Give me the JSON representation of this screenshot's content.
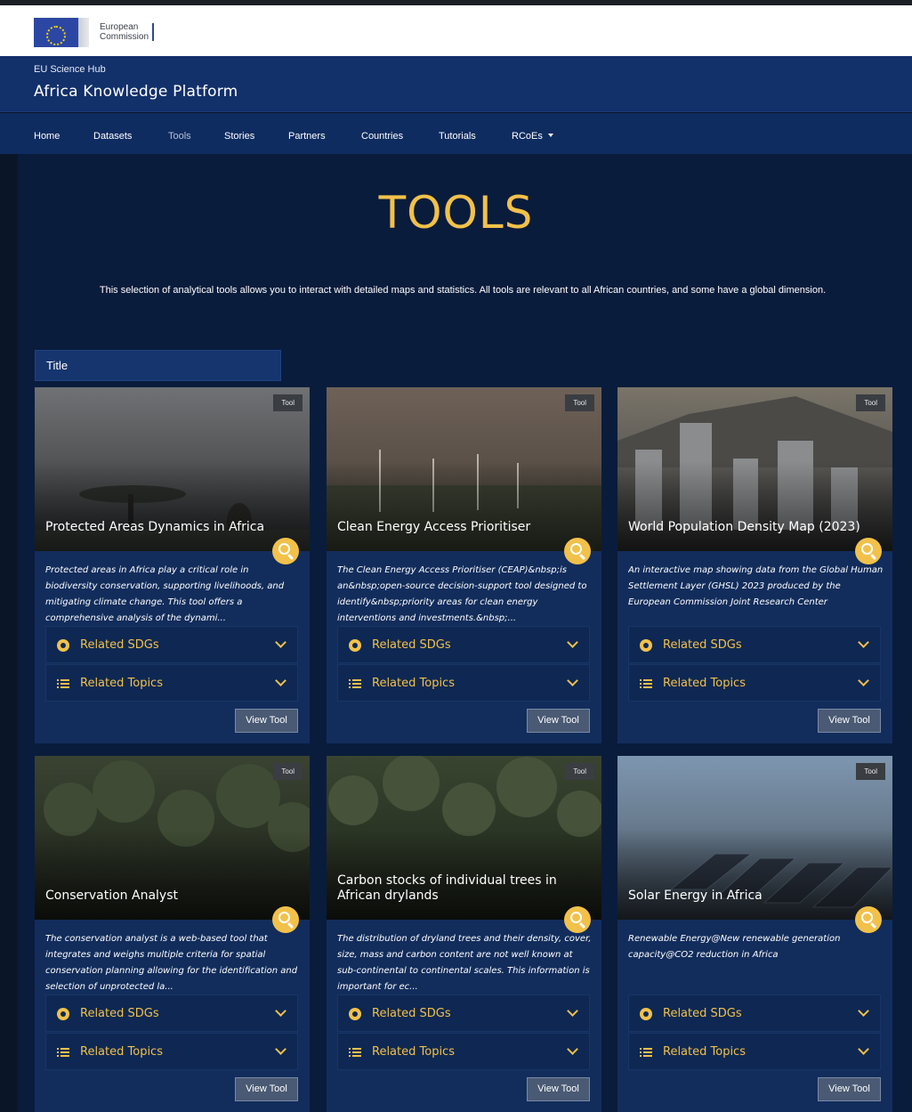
{
  "ec": {
    "line1": "European",
    "line2": "Commission"
  },
  "site": {
    "org": "EU Science Hub",
    "title": "Africa Knowledge Platform"
  },
  "nav": [
    {
      "label": "Home",
      "active": false
    },
    {
      "label": "Datasets",
      "active": false
    },
    {
      "label": "Tools",
      "active": true
    },
    {
      "label": "Stories",
      "active": false
    },
    {
      "label": "Partners",
      "active": false
    },
    {
      "label": "Countries",
      "active": false
    },
    {
      "label": "Tutorials",
      "active": false
    },
    {
      "label": "RCoEs",
      "active": false,
      "dropdown": true
    }
  ],
  "page": {
    "title": "TOOLS",
    "intro": "This selection of analytical tools allows you to interact with detailed maps and statistics. All tools are relevant to all African countries, and some have a global dimension."
  },
  "filter": {
    "label": "Title"
  },
  "common": {
    "badge": "Tool",
    "sdg_label": "Related SDGs",
    "topics_label": "Related Topics",
    "view_label": "View Tool"
  },
  "cards": [
    {
      "title": "Protected Areas Dynamics in Africa",
      "desc": "Protected areas in Africa play a critical role in biodiversity conservation, supporting livelihoods, and mitigating climate change. This tool offers a comprehensive analysis of the dynami..."
    },
    {
      "title": "Clean Energy Access Prioritiser",
      "desc": "The Clean Energy Access Prioritiser (CEAP)&nbsp;is an&nbsp;open-source decision-support tool designed to identify&nbsp;priority areas for clean energy interventions and investments.&nbsp;..."
    },
    {
      "title": "World Population Density Map (2023)",
      "desc": "An interactive map showing data from the Global Human Settlement Layer (GHSL) 2023 produced by the European Commission Joint Research Center"
    },
    {
      "title": "Conservation Analyst",
      "desc": "The conservation analyst is a web-based tool that integrates and weighs multiple criteria for spatial conservation planning allowing for the identification and selection of unprotected la..."
    },
    {
      "title": "Carbon stocks of individual trees in African drylands",
      "desc": "The distribution of dryland trees and their density, cover, size, mass and carbon content are not well known at sub-continental to continental scales. This information is important for ec..."
    },
    {
      "title": "Solar Energy in Africa",
      "desc": "Renewable Energy@New renewable generation capacity@CO2 reduction in Africa"
    }
  ]
}
